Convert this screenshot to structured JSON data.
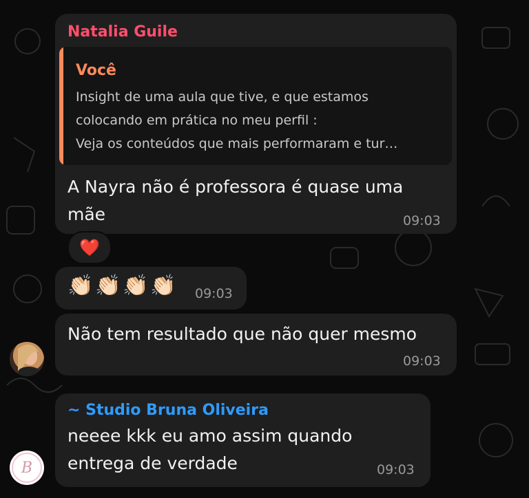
{
  "colors": {
    "sender_natalia": "#ff4f6d",
    "quote_accent": "#ff8a5c",
    "sender_studio": "#2f9bff",
    "bubble": "#1f1f1f",
    "background": "#0b0b0b"
  },
  "messages": [
    {
      "sender": "Natalia Guile",
      "quote": {
        "author": "Você",
        "lines": [
          "Insight de uma aula que tive, e que estamos",
          "colocando em prática no meu perfil :",
          "Veja os conteúdos que mais performaram  e tur…"
        ]
      },
      "text_lines": [
        "A Nayra não é professora é quase uma",
        "mãe"
      ],
      "time": "09:03",
      "reaction": "❤️"
    },
    {
      "emoji": [
        "👏🏻",
        "👏🏻",
        "👏🏻",
        "👏🏻"
      ],
      "time": "09:03"
    },
    {
      "text": "Não tem resultado que não quer mesmo",
      "time": "09:03",
      "avatar": "natalia-avatar"
    },
    {
      "sender": "~ Studio Bruna Oliveira",
      "text_lines": [
        "neeee kkk eu amo assim quando",
        "entrega de verdade"
      ],
      "time": "09:03",
      "avatar": "studio-bruna-avatar",
      "avatar_letter": "B"
    }
  ]
}
